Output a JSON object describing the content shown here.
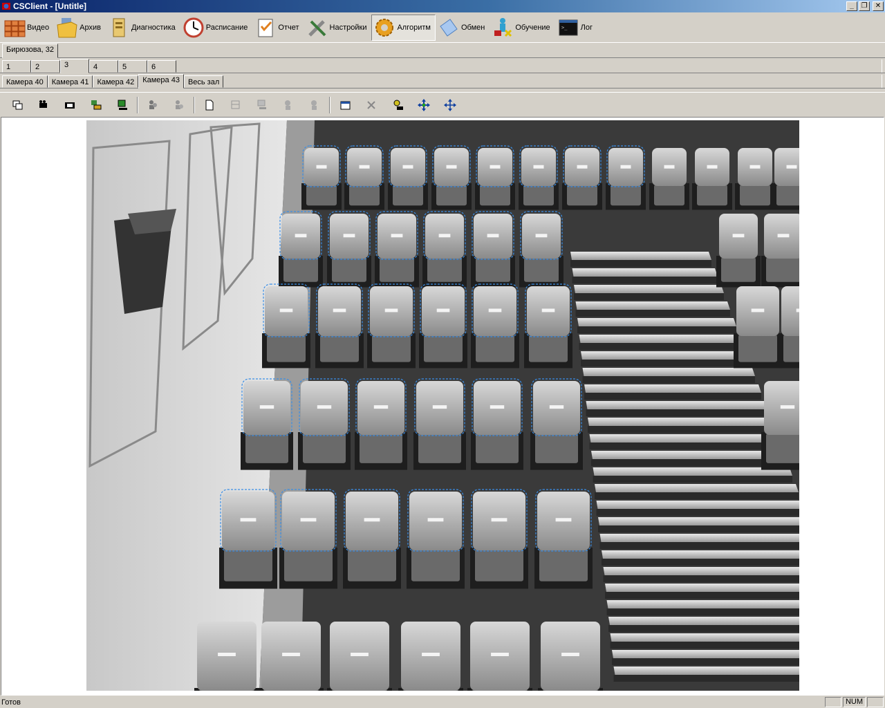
{
  "window": {
    "title": "CSClient - [Untitle]"
  },
  "menu": [
    {
      "label": "Видео",
      "icon": "video-wall-icon"
    },
    {
      "label": "Архив",
      "icon": "archive-folder-icon"
    },
    {
      "label": "Диагностика",
      "icon": "diagnostics-icon"
    },
    {
      "label": "Расписание",
      "icon": "clock-icon"
    },
    {
      "label": "Отчет",
      "icon": "report-icon"
    },
    {
      "label": "Настройки",
      "icon": "tools-icon"
    },
    {
      "label": "Алгоритм",
      "icon": "gear-icon",
      "active": true
    },
    {
      "label": "Обмен",
      "icon": "exchange-icon"
    },
    {
      "label": "Обучение",
      "icon": "training-icon"
    },
    {
      "label": "Лог",
      "icon": "console-icon"
    }
  ],
  "location_tabs": [
    "Бирюзова, 32"
  ],
  "number_tabs": [
    "1",
    "2",
    "3",
    "4",
    "5",
    "6"
  ],
  "number_tabs_selected": "3",
  "camera_tabs": [
    "Камера 40",
    "Камера 41",
    "Камера 42",
    "Камера 43",
    "Весь зал"
  ],
  "camera_tabs_selected": "Камера 43",
  "tools": [
    "copy-windows-icon",
    "camera-icon",
    "film-frame-icon",
    "layout-image-icon",
    "monitor-network-icon",
    "separator",
    "person-group-icon",
    "person-group-disabled-icon",
    "separator",
    "new-document-icon",
    "grid-disabled-icon",
    "network-disabled-icon",
    "person-gear-disabled-icon",
    "person-search-disabled-icon",
    "separator",
    "properties-icon",
    "delete-icon",
    "person-camera-icon",
    "move-arrows-icon",
    "expand-arrows-icon"
  ],
  "status": {
    "text": "Готов",
    "num": "NUM"
  },
  "colors": {
    "face": "#d4d0c8",
    "title_start": "#0a246a",
    "title_end": "#a6caf0",
    "selection": "#3a8ee6"
  }
}
